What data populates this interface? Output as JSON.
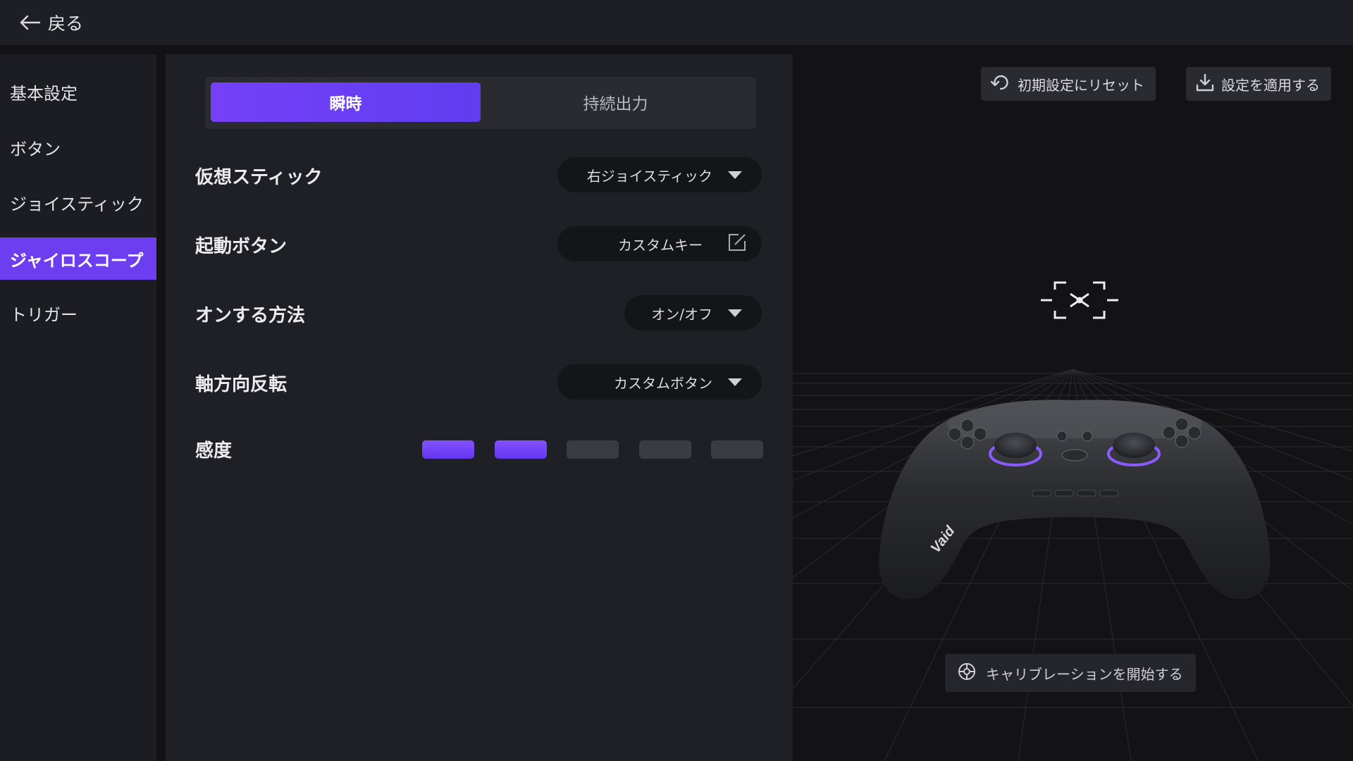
{
  "topbar": {
    "back_label": "戻る"
  },
  "sidebar": {
    "items": [
      {
        "label": "基本設定",
        "active": false
      },
      {
        "label": "ボタン",
        "active": false
      },
      {
        "label": "ジョイスティック",
        "active": false
      },
      {
        "label": "ジャイロスコープ",
        "active": true
      },
      {
        "label": "トリガー",
        "active": false
      }
    ]
  },
  "tabs": [
    {
      "label": "瞬時",
      "active": true
    },
    {
      "label": "持続出力",
      "active": false
    }
  ],
  "settings": {
    "virtual_stick": {
      "label": "仮想スティック",
      "value": "右ジョイスティック"
    },
    "activation_button": {
      "label": "起動ボタン",
      "value": "カスタムキー"
    },
    "on_method": {
      "label": "オンする方法",
      "value": "オン/オフ"
    },
    "axis_invert": {
      "label": "軸方向反転",
      "value": "カスタムボタン"
    },
    "sensitivity": {
      "label": "感度",
      "level": 2,
      "max": 5
    }
  },
  "actions": {
    "reset_label": "初期設定にリセット",
    "apply_label": "設定を適用する",
    "calibrate_label": "キャリブレーションを開始する"
  },
  "controller": {
    "brand_text": "Vaid"
  },
  "colors": {
    "accent": "#6d3df0",
    "panel": "#1f2025",
    "background": "#131316"
  },
  "icons": [
    "back-arrow-icon",
    "dropdown-caret-icon",
    "edit-icon",
    "reset-icon",
    "download-icon",
    "gyro-target-icon",
    "calibration-icon"
  ]
}
